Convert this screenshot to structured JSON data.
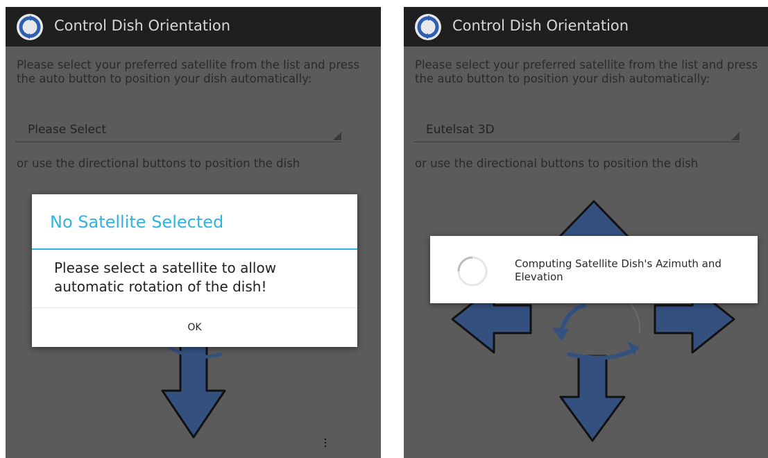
{
  "app": {
    "title": "Control Dish Orientation",
    "logo_icon": "circular-arrows-logo-icon"
  },
  "screens": {
    "left": {
      "instructions": "Please select your preferred satellite from the list and press the auto button to position your dish automatically:",
      "satellite_select": {
        "selected": "Please Select"
      },
      "alt_instructions": "or use the directional buttons to position the dish",
      "dialog": {
        "title": "No Satellite Selected",
        "message": "Please select a satellite to allow automatic rotation of the dish!",
        "ok_label": "OK"
      }
    },
    "right": {
      "instructions": "Please select your preferred satellite from the list and press the auto button to position your dish automatically:",
      "satellite_select": {
        "selected": "Eutelsat 3D"
      },
      "alt_instructions": "or use the directional buttons to position the dish",
      "progress": {
        "message": "Computing Satellite Dish's Azimuth and Elevation"
      }
    }
  },
  "colors": {
    "action_bar": "#1f1f1f",
    "screen_dim": "#5b5b5b",
    "dialog_accent": "#2fb3e0",
    "arrow_fill": "#4a70b5"
  },
  "icons": {
    "up": "arrow-up-icon",
    "down": "arrow-down-icon",
    "left": "arrow-left-icon",
    "right": "arrow-right-icon",
    "auto": "auto-rotate-icon",
    "overflow": "overflow-menu-icon"
  }
}
